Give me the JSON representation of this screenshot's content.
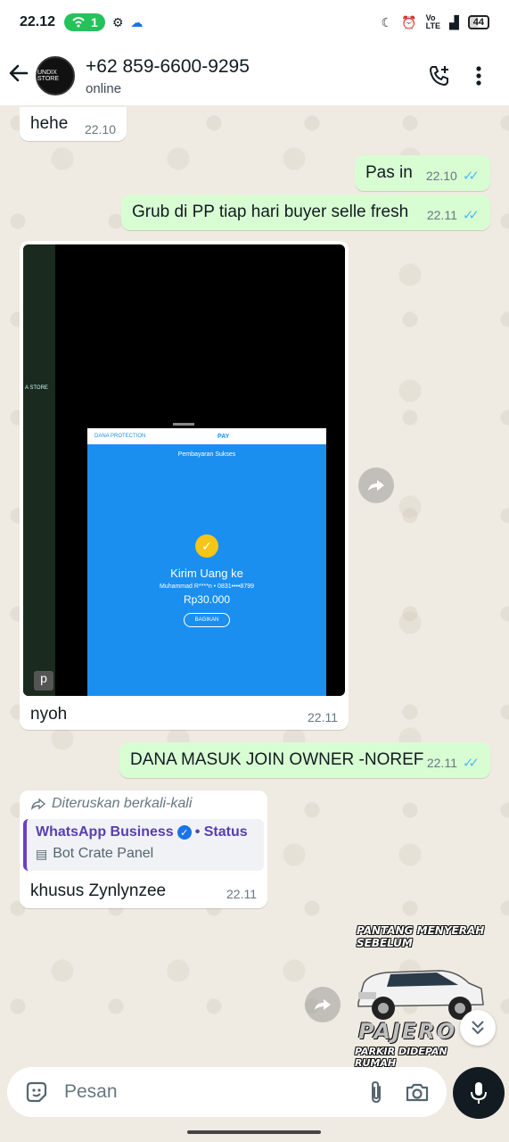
{
  "status_bar": {
    "time": "22.12",
    "notification_count": "1",
    "battery": "44"
  },
  "header": {
    "contact_name": "+62 859-6600-9295",
    "presence": "online",
    "avatar_text": "UNDIX STORE"
  },
  "messages": [
    {
      "direction": "in",
      "text": "hehe",
      "time": "22.10"
    },
    {
      "direction": "out",
      "text": "Pas in",
      "time": "22.10",
      "read": true
    },
    {
      "direction": "out",
      "text": "Grub di PP tiap hari buyer selle fresh",
      "time": "22.11",
      "read": true
    },
    {
      "direction": "in",
      "type": "media",
      "caption": "nyoh",
      "time": "22.11"
    },
    {
      "direction": "out",
      "text": "DANA MASUK JOIN OWNER -NOREF",
      "time": "22.11",
      "read": true
    },
    {
      "direction": "in",
      "forwarded_label": "Diteruskan berkali-kali",
      "quote_title": "WhatsApp Business",
      "quote_suffix": "• Status",
      "quote_sub": "Bot Crate Panel",
      "text": "khusus Zynlynzee",
      "time": "22.11"
    }
  ],
  "media_screenshot": {
    "brand": "DANA PROTECTION",
    "pay_label": "PAY",
    "success_label": "Pembayaran Sukses",
    "title": "Kirim Uang ke",
    "recipient": "Muhammad R****n • 0831••••8799",
    "amount": "Rp30.000",
    "share_label": "BAGIKAN",
    "side_label": "A STORE",
    "side_key": "p"
  },
  "sticker": {
    "line1": "PANTANG MENYERAH",
    "line2": "SEBELUM",
    "brand": "PAJERO",
    "line3": "PARKIR DIDEPAN RUMAH"
  },
  "composer": {
    "placeholder": "Pesan"
  },
  "colors": {
    "incoming_bubble": "#ffffff",
    "outgoing_bubble": "#d9fdd3",
    "read_ticks": "#53bdeb",
    "dana_blue": "#1b8ff0"
  }
}
